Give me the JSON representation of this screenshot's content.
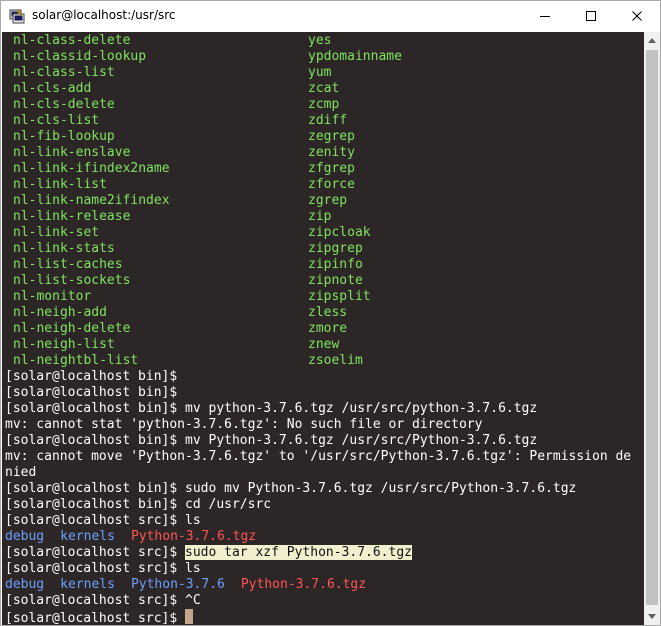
{
  "window": {
    "title": "solar@localhost:/usr/src",
    "icons": {
      "app": "putty-terminal-icon",
      "minimize": "minimize-icon",
      "maximize": "maximize-icon",
      "close": "close-icon"
    }
  },
  "terminal": {
    "listing_left": [
      "nl-class-delete",
      "nl-classid-lookup",
      "nl-class-list",
      "nl-cls-add",
      "nl-cls-delete",
      "nl-cls-list",
      "nl-fib-lookup",
      "nl-link-enslave",
      "nl-link-ifindex2name",
      "nl-link-list",
      "nl-link-name2ifindex",
      "nl-link-release",
      "nl-link-set",
      "nl-link-stats",
      "nl-list-caches",
      "nl-list-sockets",
      "nl-monitor",
      "nl-neigh-add",
      "nl-neigh-delete",
      "nl-neigh-list",
      "nl-neightbl-list"
    ],
    "listing_right": [
      "yes",
      "ypdomainname",
      "yum",
      "zcat",
      "zcmp",
      "zdiff",
      "zegrep",
      "zenity",
      "zfgrep",
      "zforce",
      "zgrep",
      "zip",
      "zipcloak",
      "zipgrep",
      "zipinfo",
      "zipnote",
      "zipsplit",
      "zless",
      "zmore",
      "znew",
      "zsoelim"
    ],
    "lines": {
      "l22": "[solar@localhost bin]$",
      "l23": "[solar@localhost bin]$",
      "l24": "[solar@localhost bin]$ mv python-3.7.6.tgz /usr/src/python-3.7.6.tgz",
      "l25": "mv: cannot stat 'python-3.7.6.tgz': No such file or directory",
      "l26": "[solar@localhost bin]$ mv Python-3.7.6.tgz /usr/src/Python-3.7.6.tgz",
      "l27": "mv: cannot move 'Python-3.7.6.tgz' to '/usr/src/Python-3.7.6.tgz': Permission de",
      "l28": "nied",
      "l29": "[solar@localhost bin]$ sudo mv Python-3.7.6.tgz /usr/src/Python-3.7.6.tgz",
      "l30": "[solar@localhost bin]$ cd /usr/src",
      "l31": "[solar@localhost src]$ ls",
      "l32": {
        "dir1": "debug",
        "dir2": "kernels",
        "file1": "Python-3.7.6.tgz"
      },
      "l33": {
        "prompt": "[solar@localhost src]$ ",
        "command": "sudo tar xzf Python-3.7.6.tgz"
      },
      "l34": "[solar@localhost src]$ ls",
      "l35": {
        "dir1": "debug",
        "dir2": "kernels",
        "dir3": "Python-3.7.6",
        "file1": "Python-3.7.6.tgz"
      },
      "l36": "[solar@localhost src]$ ^C",
      "l37": "[solar@localhost src]$ "
    },
    "colors": {
      "background": "#2d2626",
      "text": "#ffffff",
      "executable": "#7fe35f",
      "directory": "#6aa0ff",
      "archive": "#ff5555",
      "selection": "#f2efcf",
      "cursor": "#c2a68c"
    }
  }
}
